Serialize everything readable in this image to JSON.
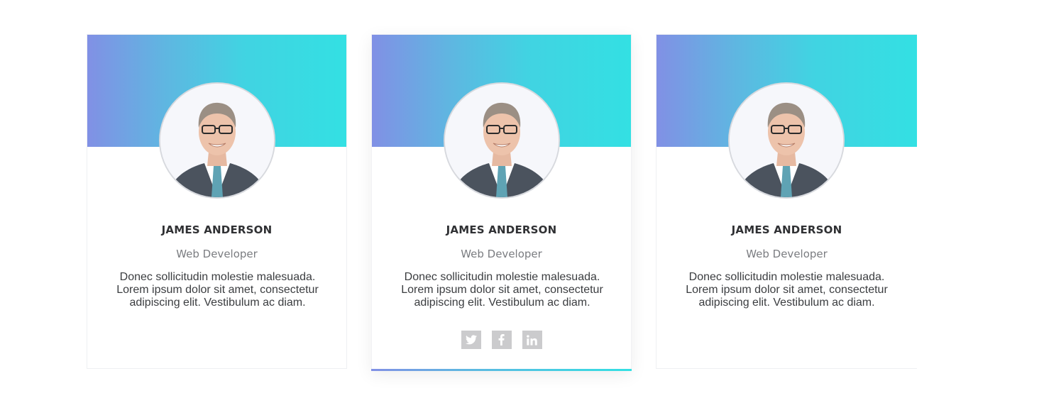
{
  "colors": {
    "gradient_start": "#8190e5",
    "gradient_end": "#33e0e3",
    "social_icon_bg": "#cbcbcd",
    "name_text": "#2f3033",
    "role_text": "#7a7c80"
  },
  "team": {
    "members": [
      {
        "name": "JAMES ANDERSON",
        "role": "Web Developer",
        "bio": "Donec sollicitudin molestie malesuada. Lorem ipsum dolor sit amet, consectetur adipiscing elit. Vestibulum ac diam.",
        "photo_icon": "person-portrait"
      },
      {
        "name": "JAMES ANDERSON",
        "role": "Web Developer",
        "bio": "Donec sollicitudin molestie malesuada. Lorem ipsum dolor sit amet, consectetur adipiscing elit. Vestibulum ac diam.",
        "photo_icon": "person-portrait",
        "social_icons": [
          "twitter-icon",
          "facebook-icon",
          "linkedin-icon"
        ]
      },
      {
        "name": "JAMES ANDERSON",
        "role": "Web Developer",
        "bio": "Donec sollicitudin molestie malesuada. Lorem ipsum dolor sit amet, consectetur adipiscing elit. Vestibulum ac diam.",
        "photo_icon": "person-portrait"
      }
    ]
  }
}
